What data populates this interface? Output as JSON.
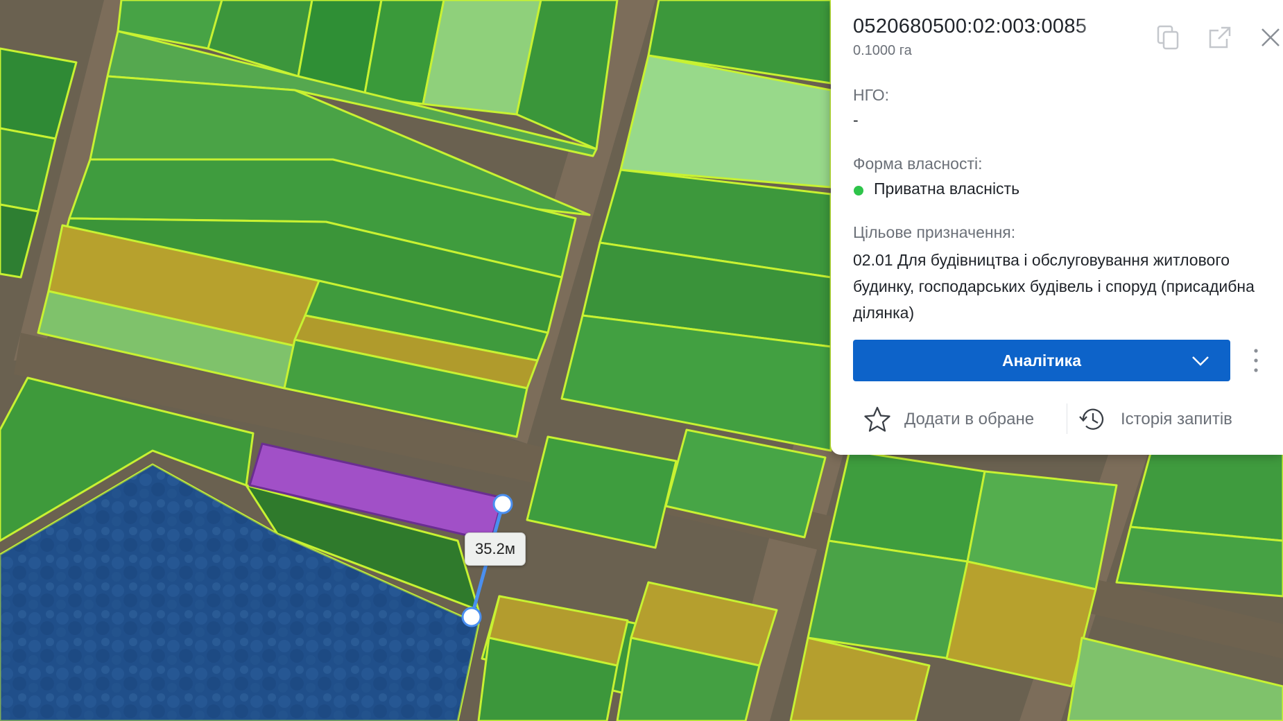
{
  "map": {
    "measure_label": "35.2м",
    "colors": {
      "road": "#7c6d5a",
      "parcel_border": "#c8f232",
      "parcel_fill_green": "#3e9a3b",
      "parcel_fill_light": "#8fd07b",
      "parcel_fill_yellow": "#b7a12d",
      "forest_fill": "#1f4f91",
      "selected_fill": "#a64fd0",
      "measure_line": "#4a8ff0"
    }
  },
  "panel": {
    "cadastral_number": "0520680500:02:003:0085",
    "area": "0.1000 га",
    "ngo_label": "НГО:",
    "ngo_value": "-",
    "ownership_label": "Форма власності:",
    "ownership_value": "Приватна власність",
    "ownership_color": "#2ec44a",
    "purpose_label": "Цільове призначення:",
    "purpose_value": "02.01 Для будівництва і обслуговування житлового будинку, господарських будівель і споруд (присадибна ділянка)",
    "analytics_label": "Аналітика",
    "analytics_color": "#0d63c9",
    "favorite_label": "Додати в обране",
    "history_label": "Історія запитів"
  }
}
